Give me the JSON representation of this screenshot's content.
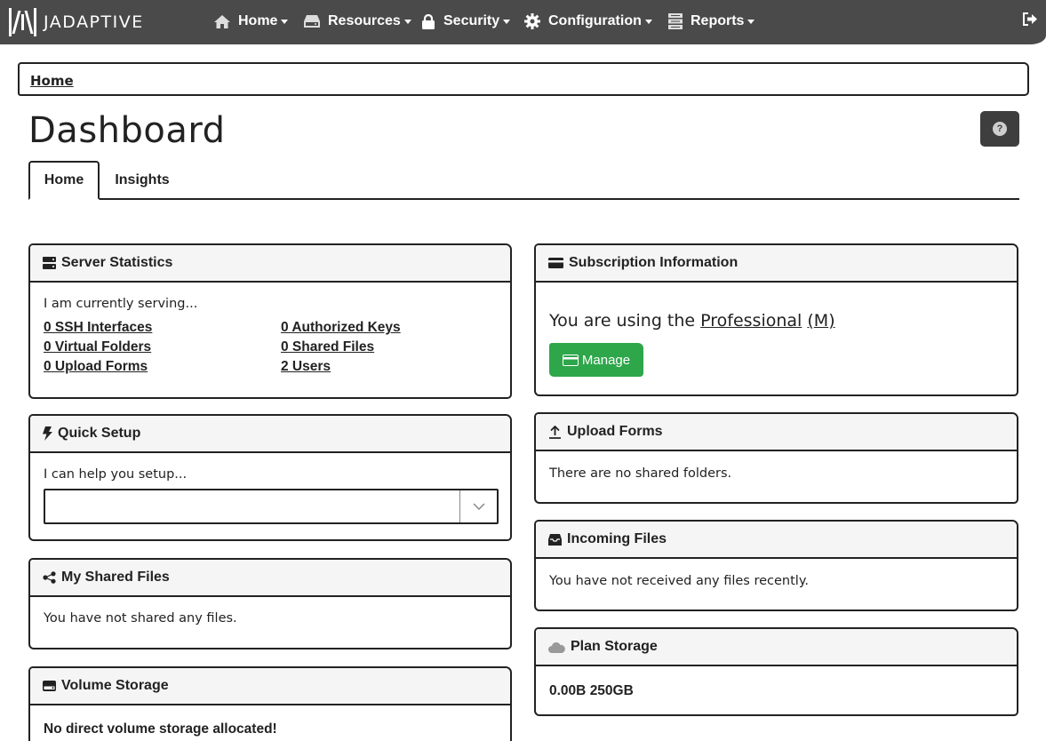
{
  "brand": {
    "name": "JADAPTIVE"
  },
  "nav": {
    "items": [
      {
        "label": "Home",
        "icon": "home-icon"
      },
      {
        "label": "Resources",
        "icon": "drive-icon"
      },
      {
        "label": "Security",
        "icon": "lock-icon"
      },
      {
        "label": "Configuration",
        "icon": "gear-icon"
      },
      {
        "label": "Reports",
        "icon": "server-icon"
      }
    ],
    "logout_icon": "sign-out-icon"
  },
  "breadcrumb": {
    "home": "Home"
  },
  "page": {
    "title": "Dashboard",
    "help_icon": "question-icon"
  },
  "tabs": [
    {
      "label": "Home",
      "active": true
    },
    {
      "label": "Insights",
      "active": false
    }
  ],
  "server_statistics": {
    "title": "Server Statistics",
    "intro": "I am currently serving...",
    "links": [
      "0 SSH Interfaces",
      "0 Authorized Keys",
      "0 Virtual Folders",
      "0 Shared Files",
      "0 Upload Forms",
      "2 Users"
    ]
  },
  "quick_setup": {
    "title": "Quick Setup",
    "intro": "I can help you setup...",
    "selected": ""
  },
  "my_shared_files": {
    "title": "My Shared Files",
    "message": "You have not shared any files."
  },
  "volume_storage": {
    "title": "Volume Storage",
    "message": "No direct volume storage allocated!"
  },
  "subscription": {
    "title": "Subscription Information",
    "prefix": "You are using the ",
    "plan": "Professional",
    "tier": "M",
    "manage_label": "Manage",
    "accent": "#2ea64a"
  },
  "upload_forms": {
    "title": "Upload Forms",
    "message": "There are no shared folders."
  },
  "incoming_files": {
    "title": "Incoming Files",
    "message": "You have not received any files recently."
  },
  "plan_storage": {
    "title": "Plan Storage",
    "used": "0.00B",
    "total": "250GB"
  },
  "colors": {
    "navbar": "#4a4a4a",
    "border": "#222222"
  }
}
